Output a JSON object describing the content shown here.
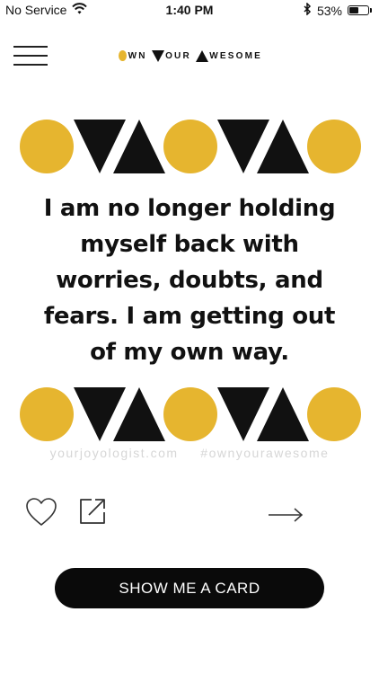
{
  "status_bar": {
    "carrier": "No Service",
    "time": "1:40 PM",
    "battery_percent": "53%",
    "battery_level": 0.53,
    "icons": [
      "wifi-icon",
      "bluetooth-icon",
      "battery-icon"
    ]
  },
  "header": {
    "menu_icon": "hamburger-menu-icon",
    "logo": {
      "part1": "WN",
      "part2": "OUR",
      "part3": "WESOME",
      "full_text": "Own Your Awesome",
      "accent": "#e6b52f"
    }
  },
  "card": {
    "shape_pattern_top": [
      "circle",
      "triangle-down",
      "triangle-up",
      "circle",
      "triangle-down",
      "triangle-up",
      "circle"
    ],
    "shape_pattern_bottom": [
      "circle",
      "triangle-down",
      "triangle-up",
      "circle",
      "triangle-down",
      "triangle-up",
      "circle"
    ],
    "affirmation_lines": [
      "I am no longer holding",
      "myself back with",
      "worries, doubts, and",
      "fears. I am getting out",
      "of my own way."
    ],
    "website": "yourjoyologist.com",
    "hashtag": "#ownyourawesome",
    "colors": {
      "gold": "#e6b52f",
      "black": "#111111"
    }
  },
  "actions": {
    "like_icon": "heart-icon",
    "share_icon": "share-external-icon",
    "next_icon": "arrow-right-icon",
    "show_card_label": "SHOW ME A CARD"
  }
}
